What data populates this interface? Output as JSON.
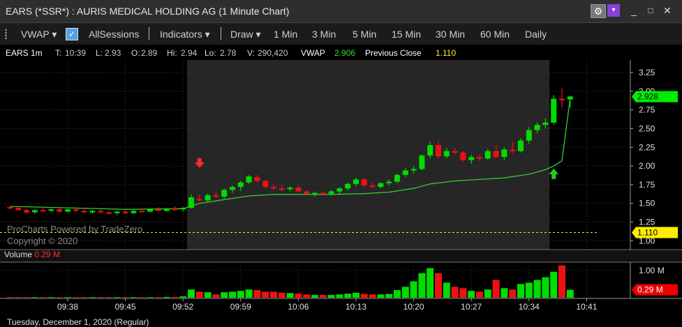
{
  "window": {
    "title": "EARS (*SSR*) : AURIS MEDICAL HOLDING AG (1 Minute Chart)",
    "gear_glyph": "⚙",
    "menu_glyph": "▾",
    "min_glyph": "_",
    "max_glyph": "□",
    "close_glyph": "✕"
  },
  "toolbar": {
    "vwap_label": "VWAP ▾",
    "allsessions_label": "AllSessions",
    "indicators_label": "Indicators ▾",
    "draw_label": "Draw ▾",
    "check_glyph": "✓",
    "intervals": [
      "1 Min",
      "3 Min",
      "5 Min",
      "15 Min",
      "30 Min",
      "60 Min",
      "Daily"
    ]
  },
  "infobar": {
    "symbol": "EARS 1m",
    "t_label": "T:",
    "t_value": "10:39",
    "l_label": "L:",
    "l_value": "2.93",
    "o_label": "O:",
    "o_value": "2.89",
    "hi_label": "Hi:",
    "hi_value": "2.94",
    "lo_label": "Lo:",
    "lo_value": "2.78",
    "v_label": "V:",
    "v_value": "290,420",
    "vwap_label": "VWAP",
    "vwap_value": "2.906",
    "prevclose_label": "Previous Close",
    "prevclose_value": "1.110"
  },
  "volume_header": {
    "label": "Volume",
    "value": "0.29 M"
  },
  "watermark": {
    "line1": "ProCharts Powered by TradeZero",
    "line2": "Copyright © 2020"
  },
  "date_label": "Tuesday, December 1, 2020 (Regular)",
  "colors": {
    "up": "#00dd00",
    "down": "#ee1111",
    "vwap": "#33cc33",
    "prev_close": "#ffee00",
    "last_price_tag": "#00ee00",
    "volume_tag": "#ee0000",
    "shaded_session": "#262626"
  },
  "chart_data": {
    "type": "candlestick",
    "price_axis": {
      "ticks": [
        "1.00",
        "1.25",
        "1.50",
        "1.75",
        "2.00",
        "2.25",
        "2.50",
        "2.75",
        "3.00",
        "3.25"
      ],
      "range": [
        0.9,
        3.4
      ]
    },
    "time_axis": {
      "ticks": [
        "09:38",
        "09:45",
        "09:52",
        "09:59",
        "10:06",
        "10:13",
        "10:20",
        "10:27",
        "10:34",
        "10:41"
      ]
    },
    "volume_axis": {
      "ticks": [
        "1.00 M"
      ],
      "range": [
        0,
        1.3
      ]
    },
    "last_price_tag": "2.928",
    "prev_close_tag": "1.110",
    "volume_tag": "0.29 M",
    "prev_close": 1.11,
    "shaded_ranges": [
      [
        "09:31",
        "09:53"
      ],
      [
        "10:37",
        "10:42"
      ]
    ],
    "annotations": [
      {
        "type": "sell-arrow",
        "time": "09:54",
        "price": 2.03
      },
      {
        "type": "buy-arrow",
        "time": "10:37",
        "price": 1.89
      }
    ],
    "candles": [
      {
        "t": "09:31",
        "o": 1.45,
        "h": 1.47,
        "l": 1.42,
        "c": 1.44,
        "v": 0.02
      },
      {
        "t": "09:32",
        "o": 1.44,
        "h": 1.46,
        "l": 1.4,
        "c": 1.41,
        "v": 0.02
      },
      {
        "t": "09:33",
        "o": 1.41,
        "h": 1.43,
        "l": 1.36,
        "c": 1.38,
        "v": 0.02
      },
      {
        "t": "09:34",
        "o": 1.38,
        "h": 1.42,
        "l": 1.36,
        "c": 1.41,
        "v": 0.02
      },
      {
        "t": "09:35",
        "o": 1.41,
        "h": 1.44,
        "l": 1.39,
        "c": 1.4,
        "v": 0.02
      },
      {
        "t": "09:36",
        "o": 1.4,
        "h": 1.43,
        "l": 1.38,
        "c": 1.42,
        "v": 0.02
      },
      {
        "t": "09:37",
        "o": 1.42,
        "h": 1.44,
        "l": 1.38,
        "c": 1.39,
        "v": 0.02
      },
      {
        "t": "09:38",
        "o": 1.39,
        "h": 1.43,
        "l": 1.38,
        "c": 1.42,
        "v": 0.02
      },
      {
        "t": "09:39",
        "o": 1.42,
        "h": 1.44,
        "l": 1.39,
        "c": 1.4,
        "v": 0.02
      },
      {
        "t": "09:40",
        "o": 1.4,
        "h": 1.42,
        "l": 1.37,
        "c": 1.38,
        "v": 0.02
      },
      {
        "t": "09:41",
        "o": 1.38,
        "h": 1.41,
        "l": 1.36,
        "c": 1.4,
        "v": 0.02
      },
      {
        "t": "09:42",
        "o": 1.4,
        "h": 1.42,
        "l": 1.37,
        "c": 1.38,
        "v": 0.02
      },
      {
        "t": "09:43",
        "o": 1.38,
        "h": 1.4,
        "l": 1.35,
        "c": 1.37,
        "v": 0.02
      },
      {
        "t": "09:44",
        "o": 1.37,
        "h": 1.4,
        "l": 1.34,
        "c": 1.39,
        "v": 0.02
      },
      {
        "t": "09:45",
        "o": 1.39,
        "h": 1.41,
        "l": 1.36,
        "c": 1.37,
        "v": 0.02
      },
      {
        "t": "09:46",
        "o": 1.37,
        "h": 1.41,
        "l": 1.36,
        "c": 1.4,
        "v": 0.02
      },
      {
        "t": "09:47",
        "o": 1.4,
        "h": 1.42,
        "l": 1.38,
        "c": 1.39,
        "v": 0.02
      },
      {
        "t": "09:48",
        "o": 1.39,
        "h": 1.43,
        "l": 1.38,
        "c": 1.42,
        "v": 0.02
      },
      {
        "t": "09:49",
        "o": 1.42,
        "h": 1.45,
        "l": 1.39,
        "c": 1.4,
        "v": 0.02
      },
      {
        "t": "09:50",
        "o": 1.4,
        "h": 1.44,
        "l": 1.39,
        "c": 1.43,
        "v": 0.03
      },
      {
        "t": "09:51",
        "o": 1.43,
        "h": 1.46,
        "l": 1.4,
        "c": 1.42,
        "v": 0.03
      },
      {
        "t": "09:52",
        "o": 1.42,
        "h": 1.45,
        "l": 1.39,
        "c": 1.44,
        "v": 0.05
      },
      {
        "t": "09:53",
        "o": 1.44,
        "h": 1.62,
        "l": 1.43,
        "c": 1.58,
        "v": 0.3
      },
      {
        "t": "09:54",
        "o": 1.56,
        "h": 1.62,
        "l": 1.52,
        "c": 1.54,
        "v": 0.22
      },
      {
        "t": "09:55",
        "o": 1.54,
        "h": 1.63,
        "l": 1.52,
        "c": 1.61,
        "v": 0.2
      },
      {
        "t": "09:56",
        "o": 1.61,
        "h": 1.66,
        "l": 1.57,
        "c": 1.59,
        "v": 0.12
      },
      {
        "t": "09:57",
        "o": 1.59,
        "h": 1.7,
        "l": 1.56,
        "c": 1.68,
        "v": 0.2
      },
      {
        "t": "09:58",
        "o": 1.68,
        "h": 1.74,
        "l": 1.64,
        "c": 1.72,
        "v": 0.22
      },
      {
        "t": "09:59",
        "o": 1.72,
        "h": 1.8,
        "l": 1.67,
        "c": 1.78,
        "v": 0.25
      },
      {
        "t": "10:00",
        "o": 1.78,
        "h": 1.88,
        "l": 1.76,
        "c": 1.86,
        "v": 0.3
      },
      {
        "t": "10:01",
        "o": 1.85,
        "h": 1.88,
        "l": 1.78,
        "c": 1.8,
        "v": 0.28
      },
      {
        "t": "10:02",
        "o": 1.8,
        "h": 1.82,
        "l": 1.7,
        "c": 1.72,
        "v": 0.22
      },
      {
        "t": "10:03",
        "o": 1.72,
        "h": 1.77,
        "l": 1.68,
        "c": 1.7,
        "v": 0.22
      },
      {
        "t": "10:04",
        "o": 1.7,
        "h": 1.75,
        "l": 1.66,
        "c": 1.69,
        "v": 0.18
      },
      {
        "t": "10:05",
        "o": 1.69,
        "h": 1.73,
        "l": 1.66,
        "c": 1.71,
        "v": 0.17
      },
      {
        "t": "10:06",
        "o": 1.71,
        "h": 1.73,
        "l": 1.65,
        "c": 1.66,
        "v": 0.15
      },
      {
        "t": "10:07",
        "o": 1.66,
        "h": 1.68,
        "l": 1.61,
        "c": 1.63,
        "v": 0.12
      },
      {
        "t": "10:08",
        "o": 1.63,
        "h": 1.66,
        "l": 1.59,
        "c": 1.64,
        "v": 0.1
      },
      {
        "t": "10:09",
        "o": 1.64,
        "h": 1.66,
        "l": 1.6,
        "c": 1.63,
        "v": 0.1
      },
      {
        "t": "10:10",
        "o": 1.63,
        "h": 1.68,
        "l": 1.6,
        "c": 1.66,
        "v": 0.1
      },
      {
        "t": "10:11",
        "o": 1.66,
        "h": 1.72,
        "l": 1.63,
        "c": 1.7,
        "v": 0.12
      },
      {
        "t": "10:12",
        "o": 1.7,
        "h": 1.78,
        "l": 1.67,
        "c": 1.76,
        "v": 0.15
      },
      {
        "t": "10:13",
        "o": 1.76,
        "h": 1.84,
        "l": 1.73,
        "c": 1.82,
        "v": 0.18
      },
      {
        "t": "10:14",
        "o": 1.82,
        "h": 1.84,
        "l": 1.72,
        "c": 1.74,
        "v": 0.14
      },
      {
        "t": "10:15",
        "o": 1.74,
        "h": 1.78,
        "l": 1.7,
        "c": 1.72,
        "v": 0.12
      },
      {
        "t": "10:16",
        "o": 1.72,
        "h": 1.78,
        "l": 1.7,
        "c": 1.77,
        "v": 0.12
      },
      {
        "t": "10:17",
        "o": 1.77,
        "h": 1.82,
        "l": 1.74,
        "c": 1.79,
        "v": 0.14
      },
      {
        "t": "10:18",
        "o": 1.79,
        "h": 1.9,
        "l": 1.77,
        "c": 1.88,
        "v": 0.28
      },
      {
        "t": "10:19",
        "o": 1.88,
        "h": 1.97,
        "l": 1.85,
        "c": 1.94,
        "v": 0.4
      },
      {
        "t": "10:20",
        "o": 1.94,
        "h": 2.0,
        "l": 1.9,
        "c": 1.96,
        "v": 0.6
      },
      {
        "t": "10:21",
        "o": 1.96,
        "h": 2.16,
        "l": 1.94,
        "c": 2.14,
        "v": 0.9
      },
      {
        "t": "10:22",
        "o": 2.14,
        "h": 2.33,
        "l": 2.1,
        "c": 2.28,
        "v": 1.08
      },
      {
        "t": "10:23",
        "o": 2.28,
        "h": 2.34,
        "l": 2.1,
        "c": 2.13,
        "v": 0.9
      },
      {
        "t": "10:24",
        "o": 2.13,
        "h": 2.24,
        "l": 2.1,
        "c": 2.2,
        "v": 0.55
      },
      {
        "t": "10:25",
        "o": 2.2,
        "h": 2.24,
        "l": 2.15,
        "c": 2.18,
        "v": 0.4
      },
      {
        "t": "10:26",
        "o": 2.18,
        "h": 2.2,
        "l": 2.05,
        "c": 2.08,
        "v": 0.35
      },
      {
        "t": "10:27",
        "o": 2.08,
        "h": 2.15,
        "l": 2.03,
        "c": 2.12,
        "v": 0.25
      },
      {
        "t": "10:28",
        "o": 2.12,
        "h": 2.16,
        "l": 2.07,
        "c": 2.1,
        "v": 0.22
      },
      {
        "t": "10:29",
        "o": 2.1,
        "h": 2.23,
        "l": 2.08,
        "c": 2.2,
        "v": 0.3
      },
      {
        "t": "10:30",
        "o": 2.2,
        "h": 2.28,
        "l": 2.1,
        "c": 2.12,
        "v": 0.65
      },
      {
        "t": "10:31",
        "o": 2.12,
        "h": 2.25,
        "l": 2.08,
        "c": 2.22,
        "v": 0.35
      },
      {
        "t": "10:32",
        "o": 2.22,
        "h": 2.32,
        "l": 2.17,
        "c": 2.2,
        "v": 0.3
      },
      {
        "t": "10:33",
        "o": 2.2,
        "h": 2.37,
        "l": 2.18,
        "c": 2.34,
        "v": 0.5
      },
      {
        "t": "10:34",
        "o": 2.34,
        "h": 2.52,
        "l": 2.3,
        "c": 2.48,
        "v": 0.55
      },
      {
        "t": "10:35",
        "o": 2.48,
        "h": 2.58,
        "l": 2.44,
        "c": 2.55,
        "v": 0.65
      },
      {
        "t": "10:36",
        "o": 2.55,
        "h": 2.64,
        "l": 2.5,
        "c": 2.58,
        "v": 0.75
      },
      {
        "t": "10:37",
        "o": 2.58,
        "h": 2.95,
        "l": 2.55,
        "c": 2.9,
        "v": 0.95
      },
      {
        "t": "10:38",
        "o": 2.9,
        "h": 3.05,
        "l": 2.78,
        "c": 2.88,
        "v": 1.18
      },
      {
        "t": "10:39",
        "o": 2.89,
        "h": 2.94,
        "l": 2.78,
        "c": 2.93,
        "v": 0.29
      }
    ],
    "vwap": [
      {
        "t": "09:31",
        "v": 1.46
      },
      {
        "t": "09:38",
        "v": 1.44
      },
      {
        "t": "09:45",
        "v": 1.42
      },
      {
        "t": "09:52",
        "v": 1.43
      },
      {
        "t": "09:54",
        "v": 1.5
      },
      {
        "t": "09:57",
        "v": 1.55
      },
      {
        "t": "10:00",
        "v": 1.6
      },
      {
        "t": "10:03",
        "v": 1.62
      },
      {
        "t": "10:06",
        "v": 1.62
      },
      {
        "t": "10:10",
        "v": 1.62
      },
      {
        "t": "10:14",
        "v": 1.63
      },
      {
        "t": "10:17",
        "v": 1.65
      },
      {
        "t": "10:20",
        "v": 1.7
      },
      {
        "t": "10:22",
        "v": 1.76
      },
      {
        "t": "10:25",
        "v": 1.8
      },
      {
        "t": "10:28",
        "v": 1.82
      },
      {
        "t": "10:31",
        "v": 1.84
      },
      {
        "t": "10:34",
        "v": 1.89
      },
      {
        "t": "10:36",
        "v": 1.95
      },
      {
        "t": "10:37",
        "v": 2.0
      },
      {
        "t": "10:38",
        "v": 2.07
      },
      {
        "t": "10:39",
        "v": 2.906
      }
    ]
  }
}
